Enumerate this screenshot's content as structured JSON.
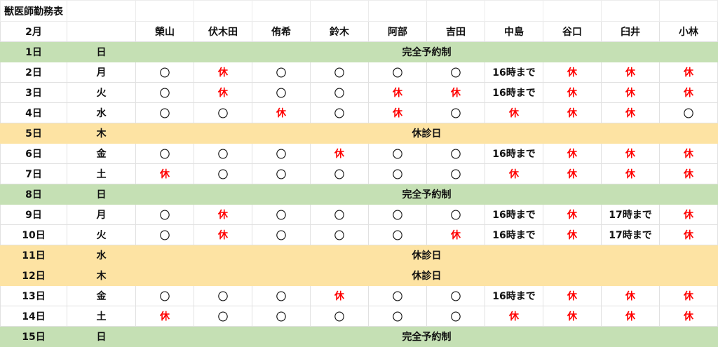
{
  "sheet_title": "獣医師勤務表",
  "month_label": "2月",
  "staff": [
    "榮山",
    "伏木田",
    "侑希",
    "鈴木",
    "阿部",
    "吉田",
    "中島",
    "谷口",
    "臼井",
    "小林"
  ],
  "legend": {
    "on": "〇",
    "off": "休"
  },
  "rows": [
    {
      "date": "1日",
      "dow": "日",
      "type": "reservation",
      "label": "完全予約制"
    },
    {
      "date": "2日",
      "dow": "月",
      "type": "normal",
      "shifts": [
        "〇",
        "休",
        "〇",
        "〇",
        "〇",
        "〇",
        "16時まで",
        "休",
        "休",
        "休"
      ]
    },
    {
      "date": "3日",
      "dow": "火",
      "type": "normal",
      "shifts": [
        "〇",
        "休",
        "〇",
        "〇",
        "休",
        "休",
        "16時まで",
        "休",
        "休",
        "休"
      ]
    },
    {
      "date": "4日",
      "dow": "水",
      "type": "normal",
      "shifts": [
        "〇",
        "〇",
        "休",
        "〇",
        "休",
        "〇",
        "休",
        "休",
        "休",
        "〇"
      ]
    },
    {
      "date": "5日",
      "dow": "木",
      "type": "holiday",
      "label": "休診日"
    },
    {
      "date": "6日",
      "dow": "金",
      "type": "normal",
      "shifts": [
        "〇",
        "〇",
        "〇",
        "休",
        "〇",
        "〇",
        "16時まで",
        "休",
        "休",
        "休"
      ]
    },
    {
      "date": "7日",
      "dow": "土",
      "type": "normal",
      "shifts": [
        "休",
        "〇",
        "〇",
        "〇",
        "〇",
        "〇",
        "休",
        "休",
        "休",
        "休"
      ]
    },
    {
      "date": "8日",
      "dow": "日",
      "type": "reservation",
      "label": "完全予約制"
    },
    {
      "date": "9日",
      "dow": "月",
      "type": "normal",
      "shifts": [
        "〇",
        "休",
        "〇",
        "〇",
        "〇",
        "〇",
        "16時まで",
        "休",
        "17時まで",
        "休"
      ]
    },
    {
      "date": "10日",
      "dow": "火",
      "type": "normal",
      "shifts": [
        "〇",
        "休",
        "〇",
        "〇",
        "〇",
        "休",
        "16時まで",
        "休",
        "17時まで",
        "休"
      ]
    },
    {
      "date": "11日",
      "dow": "水",
      "type": "holiday",
      "label": "休診日"
    },
    {
      "date": "12日",
      "dow": "木",
      "type": "holiday",
      "label": "休診日"
    },
    {
      "date": "13日",
      "dow": "金",
      "type": "normal",
      "shifts": [
        "〇",
        "〇",
        "〇",
        "休",
        "〇",
        "〇",
        "16時まで",
        "休",
        "休",
        "休"
      ]
    },
    {
      "date": "14日",
      "dow": "土",
      "type": "normal",
      "shifts": [
        "休",
        "〇",
        "〇",
        "〇",
        "〇",
        "〇",
        "休",
        "休",
        "休",
        "休"
      ]
    },
    {
      "date": "15日",
      "dow": "日",
      "type": "reservation",
      "label": "完全予約制"
    }
  ]
}
